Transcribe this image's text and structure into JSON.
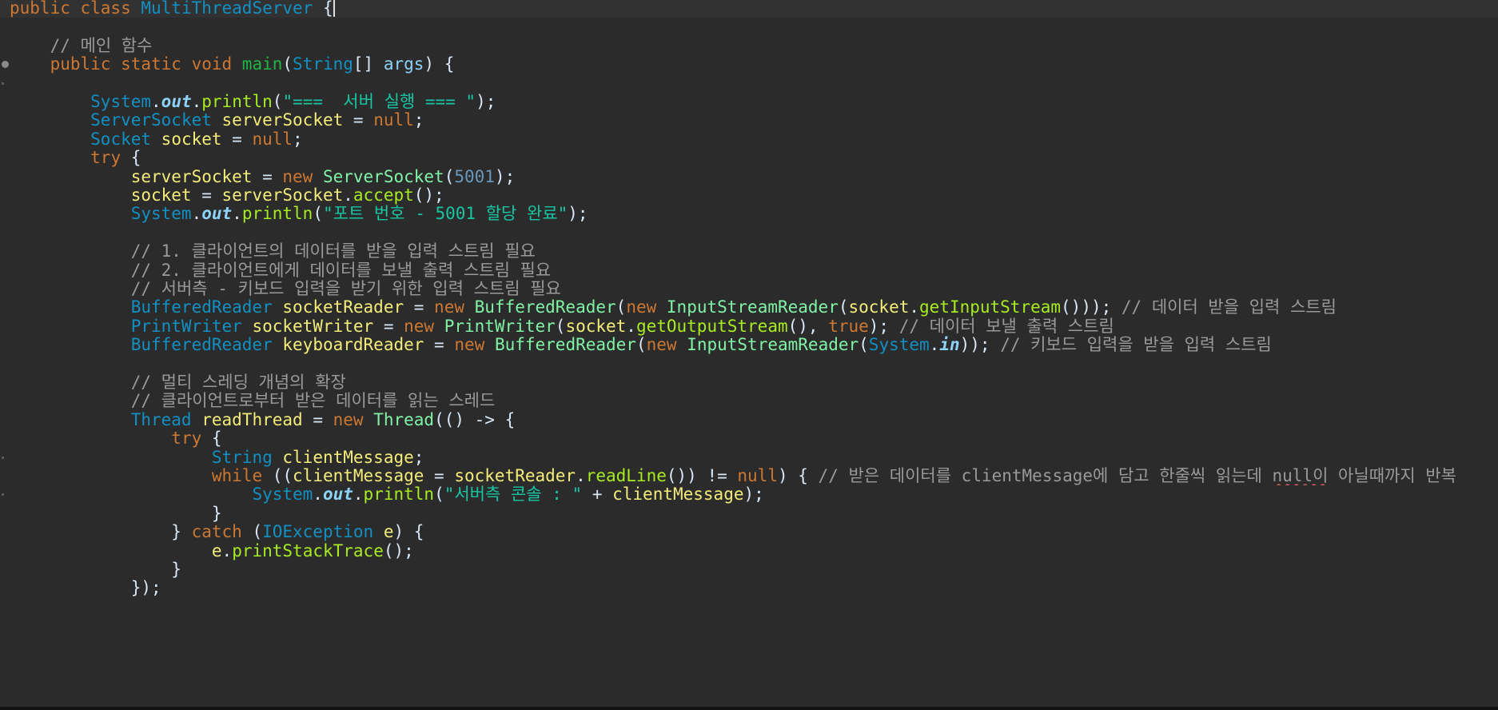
{
  "editor": {
    "language": "Java",
    "colors": {
      "background": "#2b2b2b",
      "keyword": "#cc7832",
      "type": "#1290c3",
      "class_name": "#80f2a6",
      "method_decl": "#1eb540",
      "method_call": "#a7ec21",
      "variable": "#f3ec79",
      "plain": "#d9e8f7",
      "string": "#17c6a3",
      "number": "#6897bb",
      "static_field": "#8dd2f7",
      "comment": "#9a9a9a"
    },
    "lines": [
      {
        "tokens": [
          {
            "t": "public class ",
            "c": "keyword"
          },
          {
            "t": "MultiThreadServer",
            "c": "type"
          },
          {
            "t": " {",
            "c": "plain"
          }
        ],
        "caret": true
      },
      {
        "tokens": []
      },
      {
        "tokens": [
          {
            "t": "    ",
            "c": "plain"
          },
          {
            "t": "// 메인 함수",
            "c": "comment"
          }
        ]
      },
      {
        "tokens": [
          {
            "t": "    ",
            "c": "plain"
          },
          {
            "t": "public static void ",
            "c": "keyword"
          },
          {
            "t": "main",
            "c": "method_decl"
          },
          {
            "t": "(",
            "c": "plain"
          },
          {
            "t": "String",
            "c": "type"
          },
          {
            "t": "[] ",
            "c": "plain"
          },
          {
            "t": "args",
            "c": "static_field"
          },
          {
            "t": ") {",
            "c": "plain"
          }
        ]
      },
      {
        "tokens": []
      },
      {
        "tokens": [
          {
            "t": "        ",
            "c": "plain"
          },
          {
            "t": "System",
            "c": "type"
          },
          {
            "t": ".",
            "c": "plain"
          },
          {
            "t": "out",
            "c": "static_field",
            "i": true
          },
          {
            "t": ".",
            "c": "plain"
          },
          {
            "t": "println",
            "c": "method_call"
          },
          {
            "t": "(",
            "c": "plain"
          },
          {
            "t": "\"===  서버 실행 === \"",
            "c": "string"
          },
          {
            "t": ");",
            "c": "plain"
          }
        ]
      },
      {
        "tokens": [
          {
            "t": "        ",
            "c": "plain"
          },
          {
            "t": "ServerSocket",
            "c": "type"
          },
          {
            "t": " ",
            "c": "plain"
          },
          {
            "t": "serverSocket",
            "c": "variable"
          },
          {
            "t": " = ",
            "c": "plain"
          },
          {
            "t": "null",
            "c": "keyword"
          },
          {
            "t": ";",
            "c": "plain"
          }
        ]
      },
      {
        "tokens": [
          {
            "t": "        ",
            "c": "plain"
          },
          {
            "t": "Socket",
            "c": "type"
          },
          {
            "t": " ",
            "c": "plain"
          },
          {
            "t": "socket",
            "c": "variable"
          },
          {
            "t": " = ",
            "c": "plain"
          },
          {
            "t": "null",
            "c": "keyword"
          },
          {
            "t": ";",
            "c": "plain"
          }
        ]
      },
      {
        "tokens": [
          {
            "t": "        ",
            "c": "plain"
          },
          {
            "t": "try",
            "c": "keyword"
          },
          {
            "t": " {",
            "c": "plain"
          }
        ]
      },
      {
        "tokens": [
          {
            "t": "            ",
            "c": "plain"
          },
          {
            "t": "serverSocket",
            "c": "variable"
          },
          {
            "t": " = ",
            "c": "plain"
          },
          {
            "t": "new",
            "c": "keyword"
          },
          {
            "t": " ",
            "c": "plain"
          },
          {
            "t": "ServerSocket",
            "c": "class_name"
          },
          {
            "t": "(",
            "c": "plain"
          },
          {
            "t": "5001",
            "c": "number"
          },
          {
            "t": ");",
            "c": "plain"
          }
        ]
      },
      {
        "tokens": [
          {
            "t": "            ",
            "c": "plain"
          },
          {
            "t": "socket",
            "c": "variable"
          },
          {
            "t": " = ",
            "c": "plain"
          },
          {
            "t": "serverSocket",
            "c": "variable"
          },
          {
            "t": ".",
            "c": "plain"
          },
          {
            "t": "accept",
            "c": "method_call"
          },
          {
            "t": "();",
            "c": "plain"
          }
        ]
      },
      {
        "tokens": [
          {
            "t": "            ",
            "c": "plain"
          },
          {
            "t": "System",
            "c": "type"
          },
          {
            "t": ".",
            "c": "plain"
          },
          {
            "t": "out",
            "c": "static_field",
            "i": true
          },
          {
            "t": ".",
            "c": "plain"
          },
          {
            "t": "println",
            "c": "method_call"
          },
          {
            "t": "(",
            "c": "plain"
          },
          {
            "t": "\"포트 번호 - 5001 할당 완료\"",
            "c": "string"
          },
          {
            "t": ");",
            "c": "plain"
          }
        ]
      },
      {
        "tokens": []
      },
      {
        "tokens": [
          {
            "t": "            ",
            "c": "plain"
          },
          {
            "t": "// 1. 클라이언트의 데이터를 받을 입력 스트림 필요",
            "c": "comment"
          }
        ]
      },
      {
        "tokens": [
          {
            "t": "            ",
            "c": "plain"
          },
          {
            "t": "// 2. 클라이언트에게 데이터를 보낼 출력 스트림 필요",
            "c": "comment"
          }
        ]
      },
      {
        "tokens": [
          {
            "t": "            ",
            "c": "plain"
          },
          {
            "t": "// 서버측 - 키보드 입력을 받기 위한 입력 스트림 필요",
            "c": "comment"
          }
        ]
      },
      {
        "tokens": [
          {
            "t": "            ",
            "c": "plain"
          },
          {
            "t": "BufferedReader",
            "c": "type"
          },
          {
            "t": " ",
            "c": "plain"
          },
          {
            "t": "socketReader",
            "c": "variable"
          },
          {
            "t": " = ",
            "c": "plain"
          },
          {
            "t": "new",
            "c": "keyword"
          },
          {
            "t": " ",
            "c": "plain"
          },
          {
            "t": "BufferedReader",
            "c": "class_name"
          },
          {
            "t": "(",
            "c": "plain"
          },
          {
            "t": "new",
            "c": "keyword"
          },
          {
            "t": " ",
            "c": "plain"
          },
          {
            "t": "InputStreamReader",
            "c": "class_name"
          },
          {
            "t": "(",
            "c": "plain"
          },
          {
            "t": "socket",
            "c": "variable"
          },
          {
            "t": ".",
            "c": "plain"
          },
          {
            "t": "getInputStream",
            "c": "method_call"
          },
          {
            "t": "())); ",
            "c": "plain"
          },
          {
            "t": "// 데이터 받을 입력 스트림",
            "c": "comment"
          }
        ]
      },
      {
        "tokens": [
          {
            "t": "            ",
            "c": "plain"
          },
          {
            "t": "PrintWriter",
            "c": "type"
          },
          {
            "t": " ",
            "c": "plain"
          },
          {
            "t": "socketWriter",
            "c": "variable"
          },
          {
            "t": " = ",
            "c": "plain"
          },
          {
            "t": "new",
            "c": "keyword"
          },
          {
            "t": " ",
            "c": "plain"
          },
          {
            "t": "PrintWriter",
            "c": "class_name"
          },
          {
            "t": "(",
            "c": "plain"
          },
          {
            "t": "socket",
            "c": "variable"
          },
          {
            "t": ".",
            "c": "plain"
          },
          {
            "t": "getOutputStream",
            "c": "method_call"
          },
          {
            "t": "(), ",
            "c": "plain"
          },
          {
            "t": "true",
            "c": "keyword"
          },
          {
            "t": "); ",
            "c": "plain"
          },
          {
            "t": "// 데이터 보낼 출력 스트림",
            "c": "comment"
          }
        ]
      },
      {
        "tokens": [
          {
            "t": "            ",
            "c": "plain"
          },
          {
            "t": "BufferedReader",
            "c": "type"
          },
          {
            "t": " ",
            "c": "plain"
          },
          {
            "t": "keyboardReader",
            "c": "variable"
          },
          {
            "t": " = ",
            "c": "plain"
          },
          {
            "t": "new",
            "c": "keyword"
          },
          {
            "t": " ",
            "c": "plain"
          },
          {
            "t": "BufferedReader",
            "c": "class_name"
          },
          {
            "t": "(",
            "c": "plain"
          },
          {
            "t": "new",
            "c": "keyword"
          },
          {
            "t": " ",
            "c": "plain"
          },
          {
            "t": "InputStreamReader",
            "c": "class_name"
          },
          {
            "t": "(",
            "c": "plain"
          },
          {
            "t": "System",
            "c": "type"
          },
          {
            "t": ".",
            "c": "plain"
          },
          {
            "t": "in",
            "c": "static_field",
            "i": true
          },
          {
            "t": ")); ",
            "c": "plain"
          },
          {
            "t": "// 키보드 입력을 받을 입력 스트림",
            "c": "comment"
          }
        ]
      },
      {
        "tokens": []
      },
      {
        "tokens": [
          {
            "t": "            ",
            "c": "plain"
          },
          {
            "t": "// 멀티 스레딩 개념의 확장",
            "c": "comment"
          }
        ]
      },
      {
        "tokens": [
          {
            "t": "            ",
            "c": "plain"
          },
          {
            "t": "// 클라이언트로부터 받은 데이터를 읽는 스레드",
            "c": "comment"
          }
        ]
      },
      {
        "tokens": [
          {
            "t": "            ",
            "c": "plain"
          },
          {
            "t": "Thread",
            "c": "type"
          },
          {
            "t": " ",
            "c": "plain"
          },
          {
            "t": "readThread",
            "c": "variable"
          },
          {
            "t": " = ",
            "c": "plain"
          },
          {
            "t": "new",
            "c": "keyword"
          },
          {
            "t": " ",
            "c": "plain"
          },
          {
            "t": "Thread",
            "c": "class_name"
          },
          {
            "t": "(() -> {",
            "c": "plain"
          }
        ]
      },
      {
        "tokens": [
          {
            "t": "                ",
            "c": "plain"
          },
          {
            "t": "try",
            "c": "keyword"
          },
          {
            "t": " {",
            "c": "plain"
          }
        ]
      },
      {
        "tokens": [
          {
            "t": "                    ",
            "c": "plain"
          },
          {
            "t": "String",
            "c": "type"
          },
          {
            "t": " ",
            "c": "plain"
          },
          {
            "t": "clientMessage",
            "c": "variable"
          },
          {
            "t": ";",
            "c": "plain"
          }
        ]
      },
      {
        "tokens": [
          {
            "t": "                    ",
            "c": "plain"
          },
          {
            "t": "while",
            "c": "keyword"
          },
          {
            "t": " ((",
            "c": "plain"
          },
          {
            "t": "clientMessage",
            "c": "variable"
          },
          {
            "t": " = ",
            "c": "plain"
          },
          {
            "t": "socketReader",
            "c": "variable"
          },
          {
            "t": ".",
            "c": "plain"
          },
          {
            "t": "readLine",
            "c": "method_call"
          },
          {
            "t": "()) != ",
            "c": "plain"
          },
          {
            "t": "null",
            "c": "keyword"
          },
          {
            "t": ") { ",
            "c": "plain"
          },
          {
            "t": "// 받은 데이터를 clientMessage에 담고 한줄씩 읽는데 ",
            "c": "comment"
          },
          {
            "t": "null이",
            "c": "comment",
            "u": true
          },
          {
            "t": " 아닐때까지 반복",
            "c": "comment"
          }
        ]
      },
      {
        "tokens": [
          {
            "t": "                        ",
            "c": "plain"
          },
          {
            "t": "System",
            "c": "type"
          },
          {
            "t": ".",
            "c": "plain"
          },
          {
            "t": "out",
            "c": "static_field",
            "i": true
          },
          {
            "t": ".",
            "c": "plain"
          },
          {
            "t": "println",
            "c": "method_call"
          },
          {
            "t": "(",
            "c": "plain"
          },
          {
            "t": "\"서버측 콘솔 : \"",
            "c": "string"
          },
          {
            "t": " + ",
            "c": "plain"
          },
          {
            "t": "clientMessage",
            "c": "variable"
          },
          {
            "t": ");",
            "c": "plain"
          }
        ]
      },
      {
        "tokens": [
          {
            "t": "                    }",
            "c": "plain"
          }
        ]
      },
      {
        "tokens": [
          {
            "t": "                } ",
            "c": "plain"
          },
          {
            "t": "catch",
            "c": "keyword"
          },
          {
            "t": " (",
            "c": "plain"
          },
          {
            "t": "IOException",
            "c": "type"
          },
          {
            "t": " ",
            "c": "plain"
          },
          {
            "t": "e",
            "c": "variable"
          },
          {
            "t": ") {",
            "c": "plain"
          }
        ]
      },
      {
        "tokens": [
          {
            "t": "                    ",
            "c": "plain"
          },
          {
            "t": "e",
            "c": "variable"
          },
          {
            "t": ".",
            "c": "plain"
          },
          {
            "t": "printStackTrace",
            "c": "method_call"
          },
          {
            "t": "();",
            "c": "plain"
          }
        ]
      },
      {
        "tokens": [
          {
            "t": "                }",
            "c": "plain"
          }
        ]
      },
      {
        "tokens": [
          {
            "t": "            });",
            "c": "plain"
          }
        ]
      }
    ]
  }
}
